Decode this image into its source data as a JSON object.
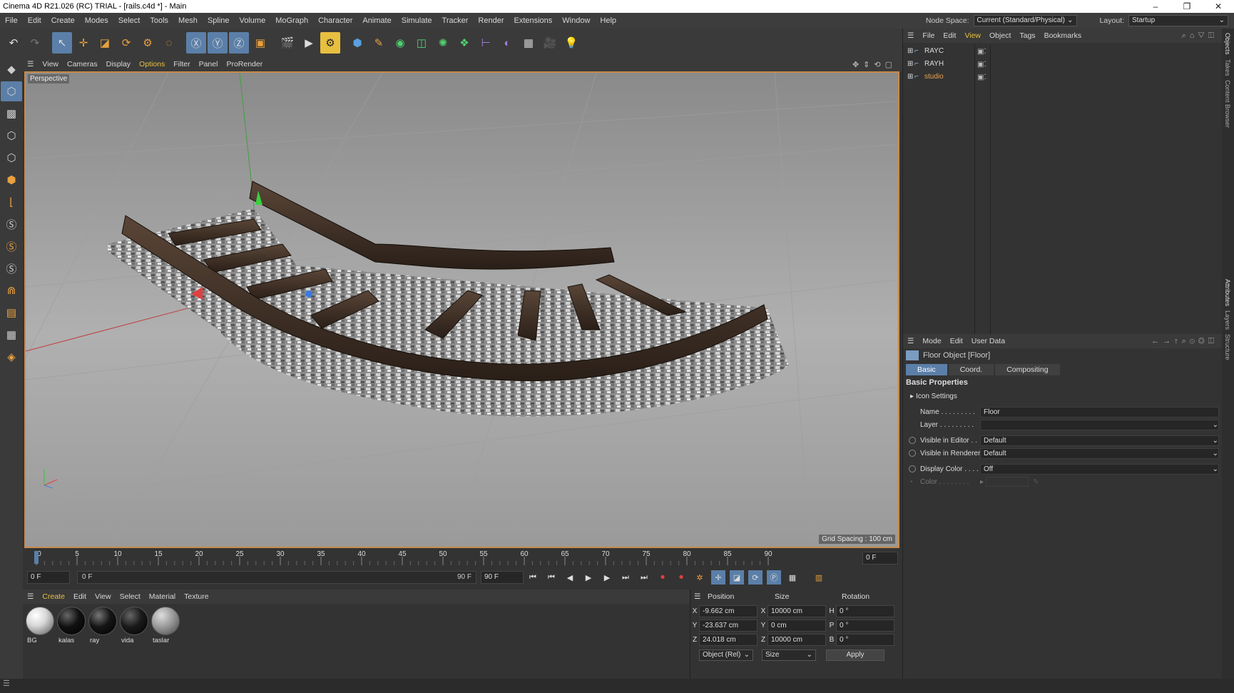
{
  "window": {
    "title": "Cinema 4D R21.026 (RC) TRIAL - [rails.c4d *] - Main",
    "min": "–",
    "max": "❐",
    "close": "✕"
  },
  "menu": [
    "File",
    "Edit",
    "Create",
    "Modes",
    "Select",
    "Tools",
    "Mesh",
    "Spline",
    "Volume",
    "MoGraph",
    "Character",
    "Animate",
    "Simulate",
    "Tracker",
    "Render",
    "Extensions",
    "Window",
    "Help"
  ],
  "nodespace": {
    "label": "Node Space:",
    "value": "Current (Standard/Physical)"
  },
  "layout": {
    "label": "Layout:",
    "value": "Startup"
  },
  "viewport": {
    "menu": [
      "View",
      "Cameras",
      "Display",
      "Options",
      "Filter",
      "Panel",
      "ProRender"
    ],
    "label": "Perspective",
    "grid_spacing": "Grid Spacing : 100 cm"
  },
  "timeline": {
    "ticks": [
      "0",
      "5",
      "10",
      "15",
      "20",
      "25",
      "30",
      "35",
      "40",
      "45",
      "50",
      "55",
      "60",
      "65",
      "70",
      "75",
      "80",
      "85",
      "90"
    ],
    "current_frame": "0 F",
    "start": "0 F",
    "range_start": "0 F",
    "range_end": "90 F",
    "end": "90 F"
  },
  "materials": {
    "menu": [
      "Create",
      "Edit",
      "View",
      "Select",
      "Material",
      "Texture"
    ],
    "items": [
      {
        "name": "BG",
        "color": "#d8d8d8"
      },
      {
        "name": "kalas",
        "color": "#111111"
      },
      {
        "name": "ray",
        "color": "#151515"
      },
      {
        "name": "vida",
        "color": "#1a1a1a"
      },
      {
        "name": "taslar",
        "color": "#9a9a9a"
      }
    ]
  },
  "coords": {
    "headers": [
      "Position",
      "Size",
      "Rotation"
    ],
    "rows": [
      {
        "axis": "X",
        "pos": "-9.662 cm",
        "saxis": "X",
        "size": "10000 cm",
        "raxis": "H",
        "rot": "0 °"
      },
      {
        "axis": "Y",
        "pos": "-23.637 cm",
        "saxis": "Y",
        "size": "0 cm",
        "raxis": "P",
        "rot": "0 °"
      },
      {
        "axis": "Z",
        "pos": "24.018 cm",
        "saxis": "Z",
        "size": "10000 cm",
        "raxis": "B",
        "rot": "0 °"
      }
    ],
    "mode": "Object (Rel)",
    "size_mode": "Size",
    "apply": "Apply"
  },
  "objects": {
    "menu": [
      "File",
      "Edit",
      "View",
      "Object",
      "Tags",
      "Bookmarks"
    ],
    "items": [
      {
        "name": "RAYC",
        "color": "#dddddd"
      },
      {
        "name": "RAYH",
        "color": "#dddddd"
      },
      {
        "name": "studio",
        "color": "#e8a050"
      }
    ]
  },
  "attributes": {
    "menu": [
      "Mode",
      "Edit",
      "User Data"
    ],
    "object_title": "Floor Object [Floor]",
    "tabs": [
      "Basic",
      "Coord.",
      "Compositing"
    ],
    "section": "Basic Properties",
    "icon_settings": "Icon Settings",
    "fields": [
      {
        "label": "Name . . . . . . . . .",
        "value": "Floor"
      },
      {
        "label": "Layer . . . . . . . . .",
        "value": ""
      }
    ],
    "dropdowns": [
      {
        "label": "Visible in Editor . .",
        "value": "Default"
      },
      {
        "label": "Visible in Renderer",
        "value": "Default"
      },
      {
        "label": "Display Color . . . .",
        "value": "Off"
      }
    ],
    "color_label": "Color . . . . . . . ."
  },
  "right_tabs": [
    "Objects",
    "Takes",
    "Content Browser",
    "Attributes",
    "Layers",
    "Structure"
  ]
}
